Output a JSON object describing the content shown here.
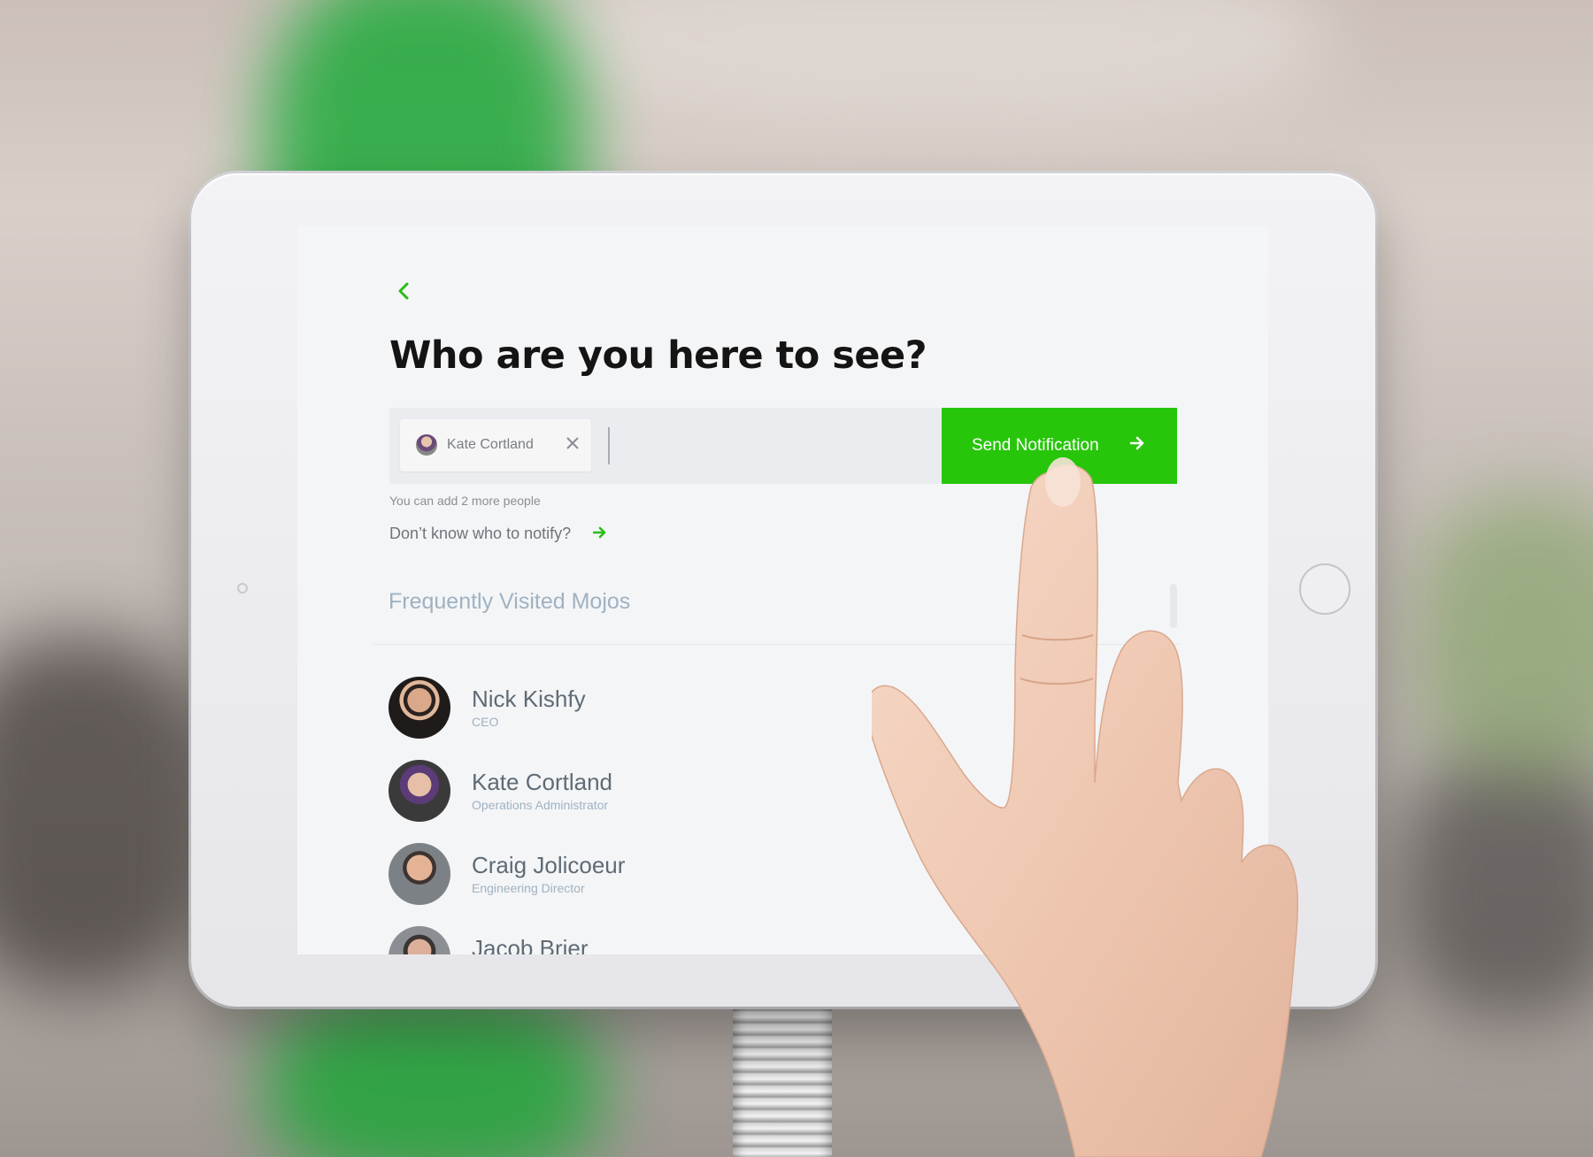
{
  "screen": {
    "title": "Who are you here to see?",
    "back_icon": "chevron-left-icon",
    "picker": {
      "selected": [
        {
          "name": "Kate Cortland"
        }
      ],
      "input_value": "",
      "send_button": "Send Notification",
      "hint": "You can add 2 more people"
    },
    "notify_link": "Don’t know who to notify?",
    "section_title": "Frequently Visited Mojos",
    "people": [
      {
        "name": "Nick Kishfy",
        "role": "CEO"
      },
      {
        "name": "Kate Cortland",
        "role": "Operations Administrator"
      },
      {
        "name": "Craig Jolicoeur",
        "role": "Engineering Director"
      },
      {
        "name": "Jacob Brier",
        "role": ""
      }
    ]
  },
  "colors": {
    "accent": "#27c60b",
    "title": "#141414",
    "section": "#9fb2c1",
    "name": "#5f6b75"
  }
}
